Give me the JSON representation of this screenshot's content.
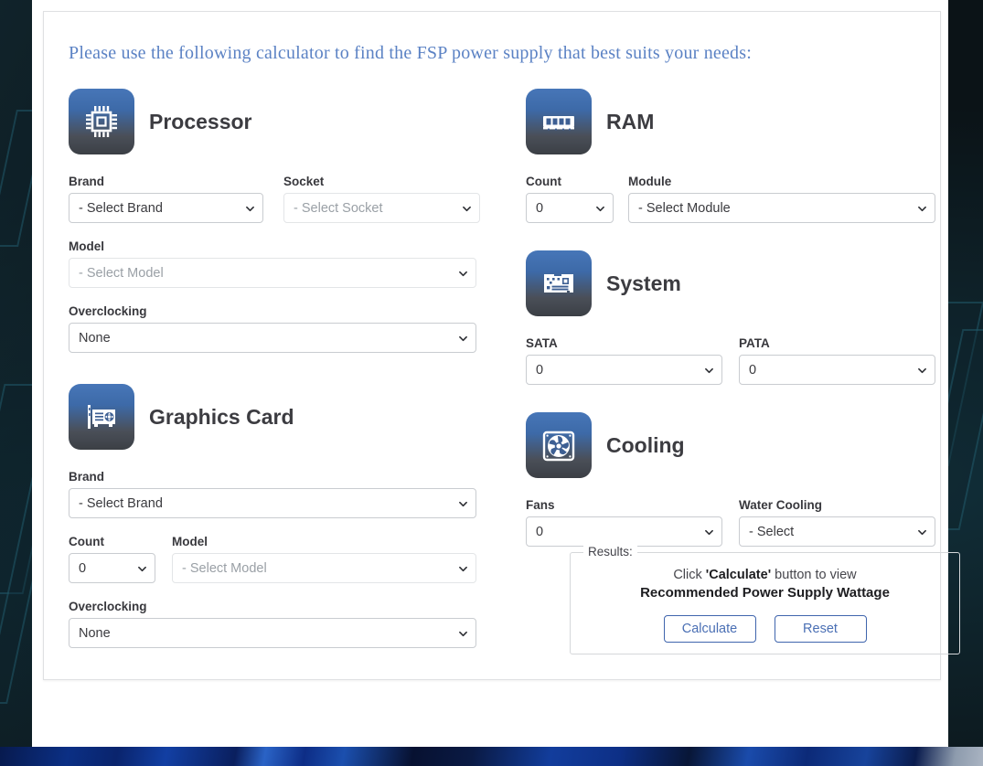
{
  "intro": {
    "text": "Please use the following calculator to find the FSP power supply that best suits your needs:"
  },
  "colors": {
    "intro_text": "#5b82c4",
    "icon_gradient_top": "#4776b8",
    "icon_gradient_bottom": "#3b3f45",
    "button_accent": "#4a6fb4",
    "label_text": "#38383d",
    "disabled_text": "#9aa0a6"
  },
  "sections": {
    "processor": {
      "title": "Processor",
      "icon": "cpu-chip-icon",
      "fields": {
        "brand": {
          "label": "Brand",
          "value": "- Select Brand",
          "disabled": false
        },
        "socket": {
          "label": "Socket",
          "value": "- Select Socket",
          "disabled": true
        },
        "model": {
          "label": "Model",
          "value": "- Select Model",
          "disabled": true
        },
        "overclocking": {
          "label": "Overclocking",
          "value": "None",
          "disabled": false
        }
      }
    },
    "graphics_card": {
      "title": "Graphics Card",
      "icon": "graphics-card-icon",
      "fields": {
        "brand": {
          "label": "Brand",
          "value": "- Select Brand",
          "disabled": false
        },
        "count": {
          "label": "Count",
          "value": "0",
          "disabled": false
        },
        "model": {
          "label": "Model",
          "value": "- Select Model",
          "disabled": true
        },
        "overclocking": {
          "label": "Overclocking",
          "value": "None",
          "disabled": false
        }
      }
    },
    "ram": {
      "title": "RAM",
      "icon": "memory-stick-icon",
      "fields": {
        "count": {
          "label": "Count",
          "value": "0",
          "disabled": false
        },
        "module": {
          "label": "Module",
          "value": "- Select Module",
          "disabled": false
        }
      }
    },
    "system": {
      "title": "System",
      "icon": "motherboard-icon",
      "fields": {
        "sata": {
          "label": "SATA",
          "value": "0",
          "disabled": false
        },
        "pata": {
          "label": "PATA",
          "value": "0",
          "disabled": false
        }
      }
    },
    "cooling": {
      "title": "Cooling",
      "icon": "fan-icon",
      "fields": {
        "fans": {
          "label": "Fans",
          "value": "0",
          "disabled": false
        },
        "water_cooling": {
          "label": "Water Cooling",
          "value": "- Select",
          "disabled": false
        }
      }
    }
  },
  "results": {
    "legend": "Results:",
    "message_line1_prefix": "Click ",
    "message_line1_strong": "'Calculate'",
    "message_line1_suffix": " button to view",
    "message_line2": "Recommended Power Supply Wattage",
    "calculate_label": "Calculate",
    "reset_label": "Reset"
  }
}
